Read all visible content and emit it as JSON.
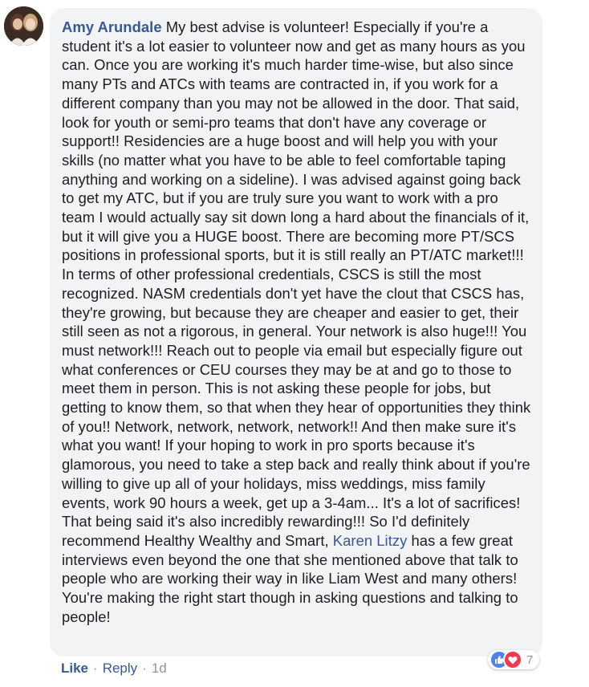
{
  "comment": {
    "author": "Amy Arundale",
    "text_part1": " My best advise is volunteer! Especially if you're a student it's a lot easier to volunteer now and get as many hours as you can. Once you are working it's much harder time-wise, but also since many PTs and ATCs with teams are contracted in, if you work for a different company than you may not be allowed in the door. That said, look for youth or semi-pro teams that don't have any coverage or support!! Residencies are a huge boost and will help you with your skills (no matter what you have to be able to feel comfortable taping anything and working on a sideline). I was advised against going back to get my ATC, but if you are truly sure you want to work with a pro team I would actually say sit down long a hard about the financials of it, but it will give you a HUGE boost. There are becoming more PT/SCS positions in professional sports, but it is still really an PT/ATC market!!! In terms of other professional credentials, CSCS is still the most recognized. NASM credentials don't yet have the clout that CSCS has, they're growing, but because they are cheaper and easier to get, their still seen as not a rigorous, in general. Your network is also huge!!! You must network!!! Reach out to people via email but especially figure out what conferences or CEU courses they may be at and go to those to meet them in person. This is not asking these people for jobs, but getting to know them, so that when they hear of opportunities they think of you!! Network, network, network, network!! And then make sure it's what you want! If your hoping to work in pro sports because it's glamorous, you need to take a step back and really think about if you're willing to give up all of your holidays, miss weddings, miss family events, work 90 hours a week, get up a 3-4am... It's a lot of sacrifices! That being said it's also incredibly rewarding!!! So I'd definitely recommend Healthy Wealthy and Smart, ",
    "mention": "Karen Litzy",
    "text_part2": " has a few great interviews even beyond the one that she mentioned above that talk to people who are working their way in like Liam West and many others! You're making the right start though in asking questions and talking to people!"
  },
  "actions": {
    "like": "Like",
    "separator": "·",
    "reply": "Reply",
    "time": "1d"
  },
  "reactions": {
    "icons": [
      "like-icon",
      "love-icon"
    ],
    "count": "7"
  },
  "colors": {
    "link": "#385898",
    "bubble": "#f2f3f5",
    "muted": "#90949c",
    "like": "#4e82ee",
    "love": "#f0394f"
  }
}
